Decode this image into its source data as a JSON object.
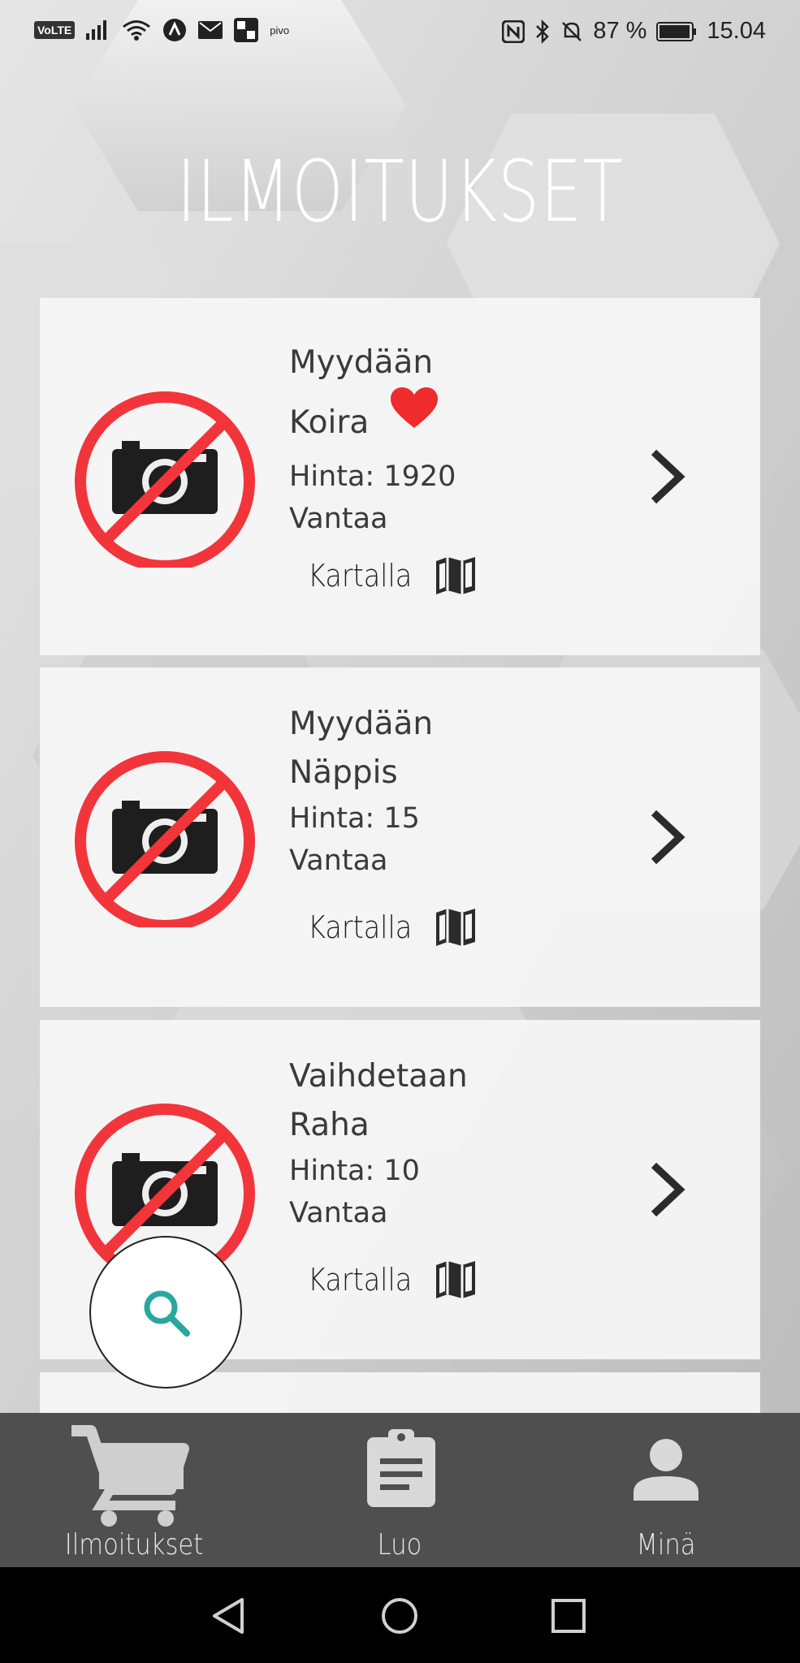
{
  "status_bar": {
    "volte": "VoLTE",
    "pivo": "pivo",
    "battery": "87 %",
    "time": "15.04"
  },
  "page": {
    "title": "ILMOITUKSET"
  },
  "listings": [
    {
      "title_line1": "Myydään",
      "title_line2": "Koira",
      "price": "Hinta: 1920",
      "city": "Vantaa",
      "map_label": "Kartalla",
      "favorite": true
    },
    {
      "title_line1": "Myydään",
      "title_line2": "Näppis",
      "price": "Hinta: 15",
      "city": "Vantaa",
      "map_label": "Kartalla",
      "favorite": false
    },
    {
      "title_line1": "Vaihdetaan",
      "title_line2": "Raha",
      "price": "Hinta: 10",
      "city": "Vantaa",
      "map_label": "Kartalla",
      "favorite": false
    }
  ],
  "bottom_nav": {
    "items": [
      {
        "label": "Ilmoitukset",
        "icon": "cart-icon",
        "active": true
      },
      {
        "label": "Luo",
        "icon": "clipboard-icon",
        "active": false
      },
      {
        "label": "Minä",
        "icon": "person-icon",
        "active": false
      }
    ]
  },
  "colors": {
    "no_photo_red": "#f2353b",
    "heart": "#ef2b2b",
    "search_accent": "#2aa6a0",
    "nav_bg": "#4f4f4f"
  }
}
